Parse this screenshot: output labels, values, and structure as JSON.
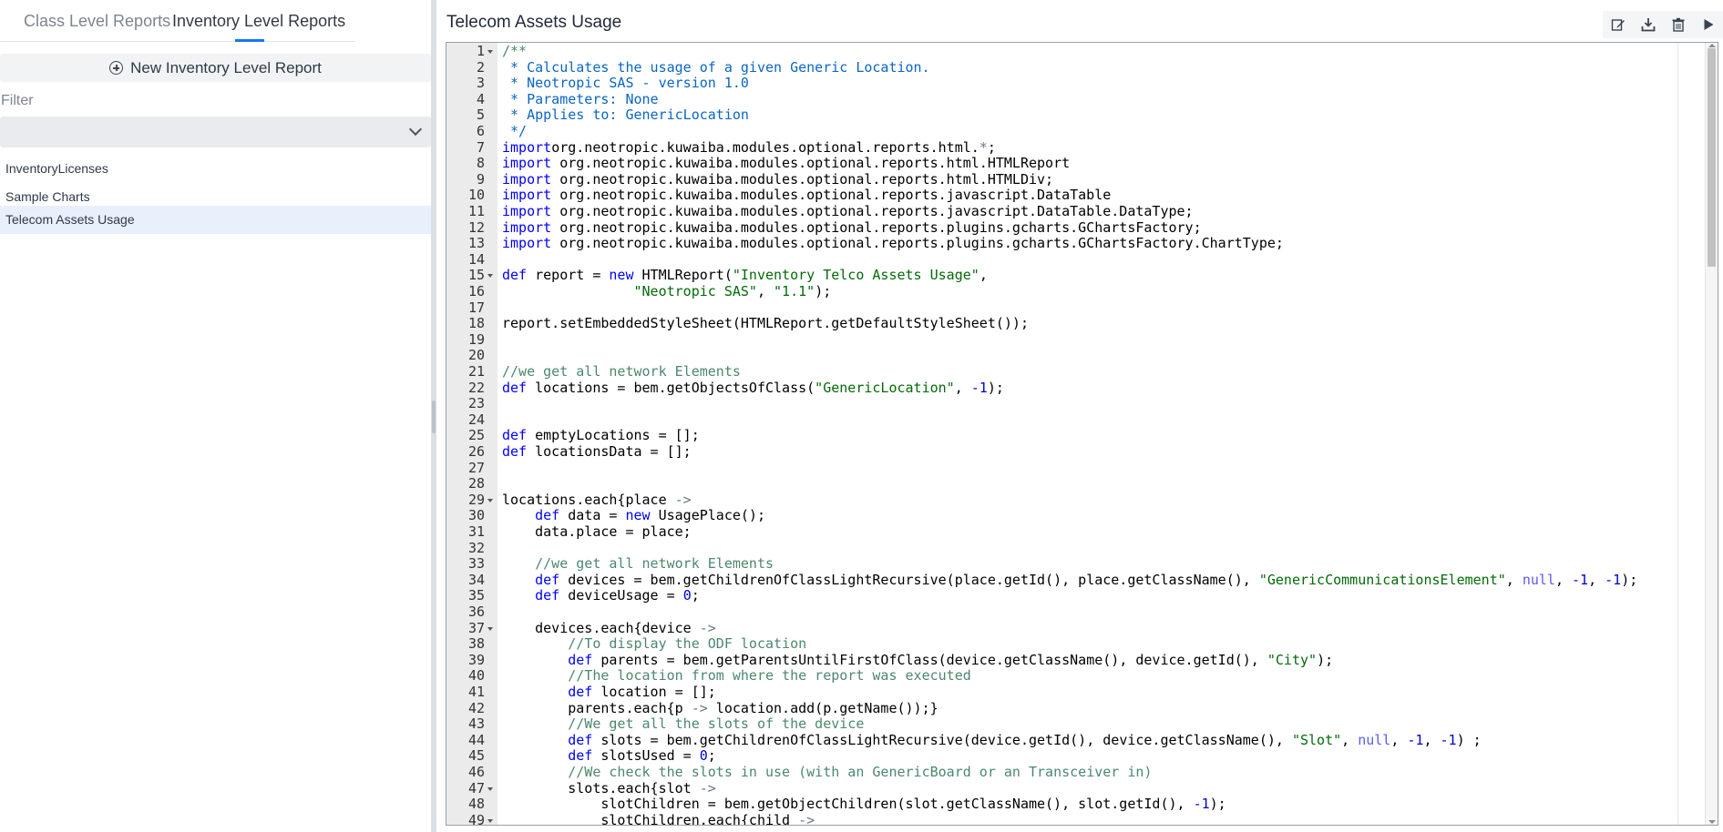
{
  "tabs": [
    {
      "label": "Class Level Reports",
      "active": false
    },
    {
      "label": "Inventory Level Reports",
      "active": true
    }
  ],
  "sidebar": {
    "new_report_label": "New Inventory Level Report",
    "filter_label": "Filter",
    "filter_value": "",
    "items": [
      {
        "label": "InventoryLicenses",
        "selected": false
      },
      {
        "label": "Sample Charts",
        "selected": false
      },
      {
        "label": "Telecom Assets Usage",
        "selected": true
      }
    ]
  },
  "report": {
    "title": "Telecom Assets Usage",
    "toolbar": [
      {
        "icon": "edit-icon",
        "tooltip": "edit"
      },
      {
        "icon": "download-icon",
        "tooltip": "download"
      },
      {
        "icon": "trash-icon",
        "tooltip": "delete"
      },
      {
        "icon": "play-icon",
        "tooltip": "run"
      }
    ]
  },
  "editor": {
    "fold_lines": [
      1,
      15,
      29,
      37,
      47,
      49
    ],
    "lines": [
      [
        [
          "c",
          "/**"
        ]
      ],
      [
        [
          "d",
          " * Calculates the usage of a given Generic Location."
        ]
      ],
      [
        [
          "d",
          " * Neotropic SAS - version 1.0"
        ]
      ],
      [
        [
          "d",
          " * Parameters: None"
        ]
      ],
      [
        [
          "d",
          " * Applies to: GenericLocation"
        ]
      ],
      [
        [
          "d",
          " */"
        ]
      ],
      [
        [
          "k",
          "import"
        ],
        [
          "",
          "org.neotropic.kuwaiba.modules.optional.reports.html."
        ],
        [
          "op",
          "*"
        ],
        [
          "",
          ";"
        ]
      ],
      [
        [
          "k",
          "import"
        ],
        [
          "",
          " org.neotropic.kuwaiba.modules.optional.reports.html.HTMLReport"
        ]
      ],
      [
        [
          "k",
          "import"
        ],
        [
          "",
          " org.neotropic.kuwaiba.modules.optional.reports.html.HTMLDiv;"
        ]
      ],
      [
        [
          "k",
          "import"
        ],
        [
          "",
          " org.neotropic.kuwaiba.modules.optional.reports.javascript.DataTable"
        ]
      ],
      [
        [
          "k",
          "import"
        ],
        [
          "",
          " org.neotropic.kuwaiba.modules.optional.reports.javascript.DataTable.DataType;"
        ]
      ],
      [
        [
          "k",
          "import"
        ],
        [
          "",
          " org.neotropic.kuwaiba.modules.optional.reports.plugins.gcharts.GChartsFactory;"
        ]
      ],
      [
        [
          "k",
          "import"
        ],
        [
          "",
          " org.neotropic.kuwaiba.modules.optional.reports.plugins.gcharts.GChartsFactory.ChartType;"
        ]
      ],
      [],
      [
        [
          "k",
          "def"
        ],
        [
          "",
          " report = "
        ],
        [
          "k",
          "new"
        ],
        [
          "",
          " HTMLReport("
        ],
        [
          "s",
          "\"Inventory Telco Assets Usage\""
        ],
        [
          "",
          ","
        ]
      ],
      [
        [
          "",
          "                "
        ],
        [
          "s",
          "\"Neotropic SAS\""
        ],
        [
          "",
          ", "
        ],
        [
          "s",
          "\"1.1\""
        ],
        [
          "",
          ");"
        ]
      ],
      [],
      [
        [
          "",
          "report.setEmbeddedStyleSheet(HTMLReport.getDefaultStyleSheet());"
        ]
      ],
      [],
      [],
      [
        [
          "c",
          "//we get all network Elements"
        ]
      ],
      [
        [
          "k",
          "def"
        ],
        [
          "",
          " locations = bem.getObjectsOfClass("
        ],
        [
          "s",
          "\"GenericLocation\""
        ],
        [
          "",
          ", "
        ],
        [
          "n",
          "-1"
        ],
        [
          "",
          ");"
        ]
      ],
      [],
      [],
      [
        [
          "k",
          "def"
        ],
        [
          "",
          " emptyLocations = [];"
        ]
      ],
      [
        [
          "k",
          "def"
        ],
        [
          "",
          " locationsData = [];"
        ]
      ],
      [],
      [],
      [
        [
          "",
          "locations.each{place "
        ],
        [
          "op",
          "->"
        ]
      ],
      [
        [
          "",
          "    "
        ],
        [
          "k",
          "def"
        ],
        [
          "",
          " data = "
        ],
        [
          "k",
          "new"
        ],
        [
          "",
          " UsagePlace();"
        ]
      ],
      [
        [
          "",
          "    data.place = place;"
        ]
      ],
      [],
      [
        [
          "",
          "    "
        ],
        [
          "c",
          "//we get all network Elements"
        ]
      ],
      [
        [
          "",
          "    "
        ],
        [
          "k",
          "def"
        ],
        [
          "",
          " devices = bem.getChildrenOfClassLightRecursive(place.getId(), place.getClassName(), "
        ],
        [
          "s",
          "\"GenericCommunicationsElement\""
        ],
        [
          "",
          ", "
        ],
        [
          "nl",
          "null"
        ],
        [
          "",
          ", "
        ],
        [
          "n",
          "-1"
        ],
        [
          "",
          ", "
        ],
        [
          "n",
          "-1"
        ],
        [
          "",
          ");"
        ]
      ],
      [
        [
          "",
          "    "
        ],
        [
          "k",
          "def"
        ],
        [
          "",
          " deviceUsage = "
        ],
        [
          "n",
          "0"
        ],
        [
          "",
          ";"
        ]
      ],
      [],
      [
        [
          "",
          "    devices.each{device "
        ],
        [
          "op",
          "->"
        ]
      ],
      [
        [
          "",
          "        "
        ],
        [
          "c",
          "//To display the ODF location"
        ]
      ],
      [
        [
          "",
          "        "
        ],
        [
          "k",
          "def"
        ],
        [
          "",
          " parents = bem.getParentsUntilFirstOfClass(device.getClassName(), device.getId(), "
        ],
        [
          "s",
          "\"City\""
        ],
        [
          "",
          ");"
        ]
      ],
      [
        [
          "",
          "        "
        ],
        [
          "c",
          "//The location from where the report was executed"
        ]
      ],
      [
        [
          "",
          "        "
        ],
        [
          "k",
          "def"
        ],
        [
          "",
          " location = [];"
        ]
      ],
      [
        [
          "",
          "        parents.each{p "
        ],
        [
          "op",
          "->"
        ],
        [
          "",
          " location.add(p.getName());}"
        ]
      ],
      [
        [
          "",
          "        "
        ],
        [
          "c",
          "//We get all the slots of the device"
        ]
      ],
      [
        [
          "",
          "        "
        ],
        [
          "k",
          "def"
        ],
        [
          "",
          " slots = bem.getChildrenOfClassLightRecursive(device.getId(), device.getClassName(), "
        ],
        [
          "s",
          "\"Slot\""
        ],
        [
          "",
          ", "
        ],
        [
          "nl",
          "null"
        ],
        [
          "",
          ", "
        ],
        [
          "n",
          "-1"
        ],
        [
          "",
          ", "
        ],
        [
          "n",
          "-1"
        ],
        [
          "",
          ") ;"
        ]
      ],
      [
        [
          "",
          "        "
        ],
        [
          "k",
          "def"
        ],
        [
          "",
          " slotsUsed = "
        ],
        [
          "n",
          "0"
        ],
        [
          "",
          ";"
        ]
      ],
      [
        [
          "",
          "        "
        ],
        [
          "c",
          "//We check the slots in use (with an GenericBoard or an Transceiver in)"
        ]
      ],
      [
        [
          "",
          "        slots.each{slot "
        ],
        [
          "op",
          "->"
        ]
      ],
      [
        [
          "",
          "            slotChildren = bem.getObjectChildren(slot.getClassName(), slot.getId(), "
        ],
        [
          "n",
          "-1"
        ],
        [
          "",
          ");"
        ]
      ],
      [
        [
          "",
          "            slotChildren.each{child "
        ],
        [
          "op",
          "->"
        ]
      ]
    ]
  }
}
